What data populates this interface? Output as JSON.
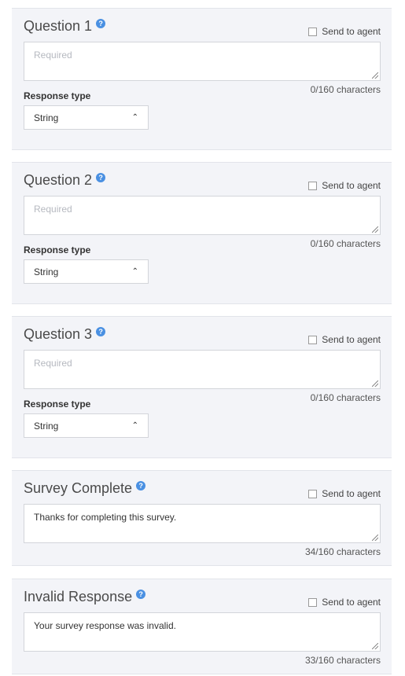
{
  "send_to_agent_label": "Send to agent",
  "questions": [
    {
      "title": "Question 1",
      "placeholder": "Required",
      "counter": "0/160 characters",
      "response_type_label": "Response type",
      "response_type_value": "String"
    },
    {
      "title": "Question 2",
      "placeholder": "Required",
      "counter": "0/160 characters",
      "response_type_label": "Response type",
      "response_type_value": "String"
    },
    {
      "title": "Question 3",
      "placeholder": "Required",
      "counter": "0/160 characters",
      "response_type_label": "Response type",
      "response_type_value": "String"
    }
  ],
  "survey_complete": {
    "title": "Survey Complete",
    "value": "Thanks for completing this survey.",
    "counter": "34/160 characters"
  },
  "invalid_response": {
    "title": "Invalid Response",
    "value": "Your survey response was invalid.",
    "counter": "33/160 characters"
  },
  "icons": {
    "help": "question-circle-icon",
    "select_caret": "chevron-up-icon",
    "resize": "resize-grip-icon"
  },
  "colors": {
    "card_bg": "#f3f4f8",
    "help_icon": "#4a90e2"
  }
}
